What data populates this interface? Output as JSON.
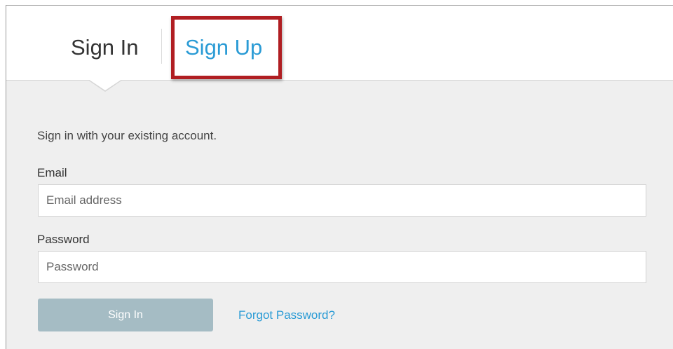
{
  "tabs": {
    "sign_in": "Sign In",
    "sign_up": "Sign Up"
  },
  "form": {
    "intro_text": "Sign in with your existing account.",
    "email_label": "Email",
    "email_placeholder": "Email address",
    "email_value": "",
    "password_label": "Password",
    "password_placeholder": "Password",
    "password_value": "",
    "submit_label": "Sign In",
    "forgot_label": "Forgot Password?"
  },
  "colors": {
    "accent": "#2a9bd5",
    "highlight": "#b01e22",
    "button_disabled": "#a5bcc4",
    "panel_background": "#efefef"
  }
}
